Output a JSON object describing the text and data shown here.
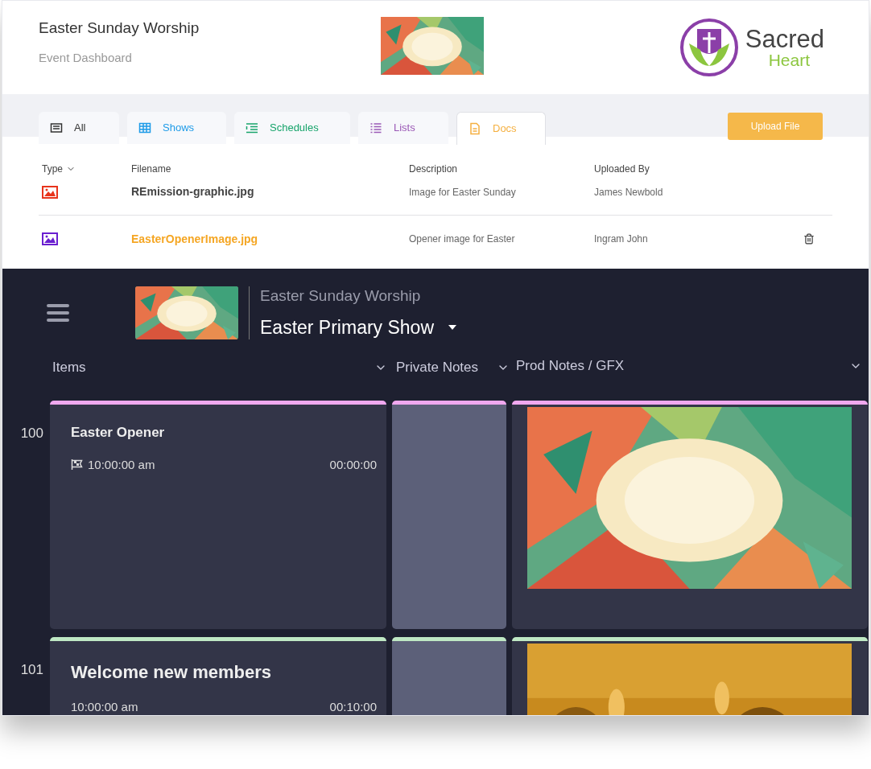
{
  "header": {
    "title": "Easter Sunday Worship",
    "subtitle": "Event Dashboard",
    "logo": {
      "word_1": "Sacred",
      "word_2": "Heart"
    }
  },
  "tabs": [
    {
      "label": "All",
      "kind": "card",
      "color": "#333333",
      "selected": false
    },
    {
      "label": "Shows",
      "kind": "grid",
      "color": "#1e9be8",
      "selected": false
    },
    {
      "label": "Schedules",
      "kind": "schedule",
      "color": "#17a46b",
      "selected": false
    },
    {
      "label": "Lists",
      "kind": "list",
      "color": "#9b59b6",
      "selected": false
    },
    {
      "label": "Docs",
      "kind": "doc",
      "color": "#f5b041",
      "selected": true
    }
  ],
  "upload_button": "Upload File",
  "table": {
    "columns": [
      "Type",
      "Filename",
      "Description",
      "Uploaded By"
    ],
    "rows": [
      {
        "color": "#e8341c",
        "filename": "REmission-graphic.jpg",
        "description": "Image for Easter Sunday",
        "uploaded_by": "James Newbold",
        "selected": false
      },
      {
        "color": "#6a1fd0",
        "filename": "EasterOpenerImage.jpg",
        "description": "Opener image for Easter",
        "uploaded_by": "Ingram John",
        "selected": true
      }
    ]
  },
  "show": {
    "event": "Easter Sunday Worship",
    "name": "Easter Primary Show",
    "columns": [
      "Items",
      "Private Notes",
      "Prod Notes / GFX"
    ],
    "items": [
      {
        "number": "100",
        "title": "Easter Opener",
        "flag": true,
        "start": "10:00:00 am",
        "duration": "00:00:00",
        "color": "#f0a8ef"
      },
      {
        "number": "101",
        "title": "Welcome new members",
        "flag": false,
        "start": "10:00:00 am",
        "duration": "00:10:00",
        "color": "#bfe8c4"
      }
    ]
  }
}
